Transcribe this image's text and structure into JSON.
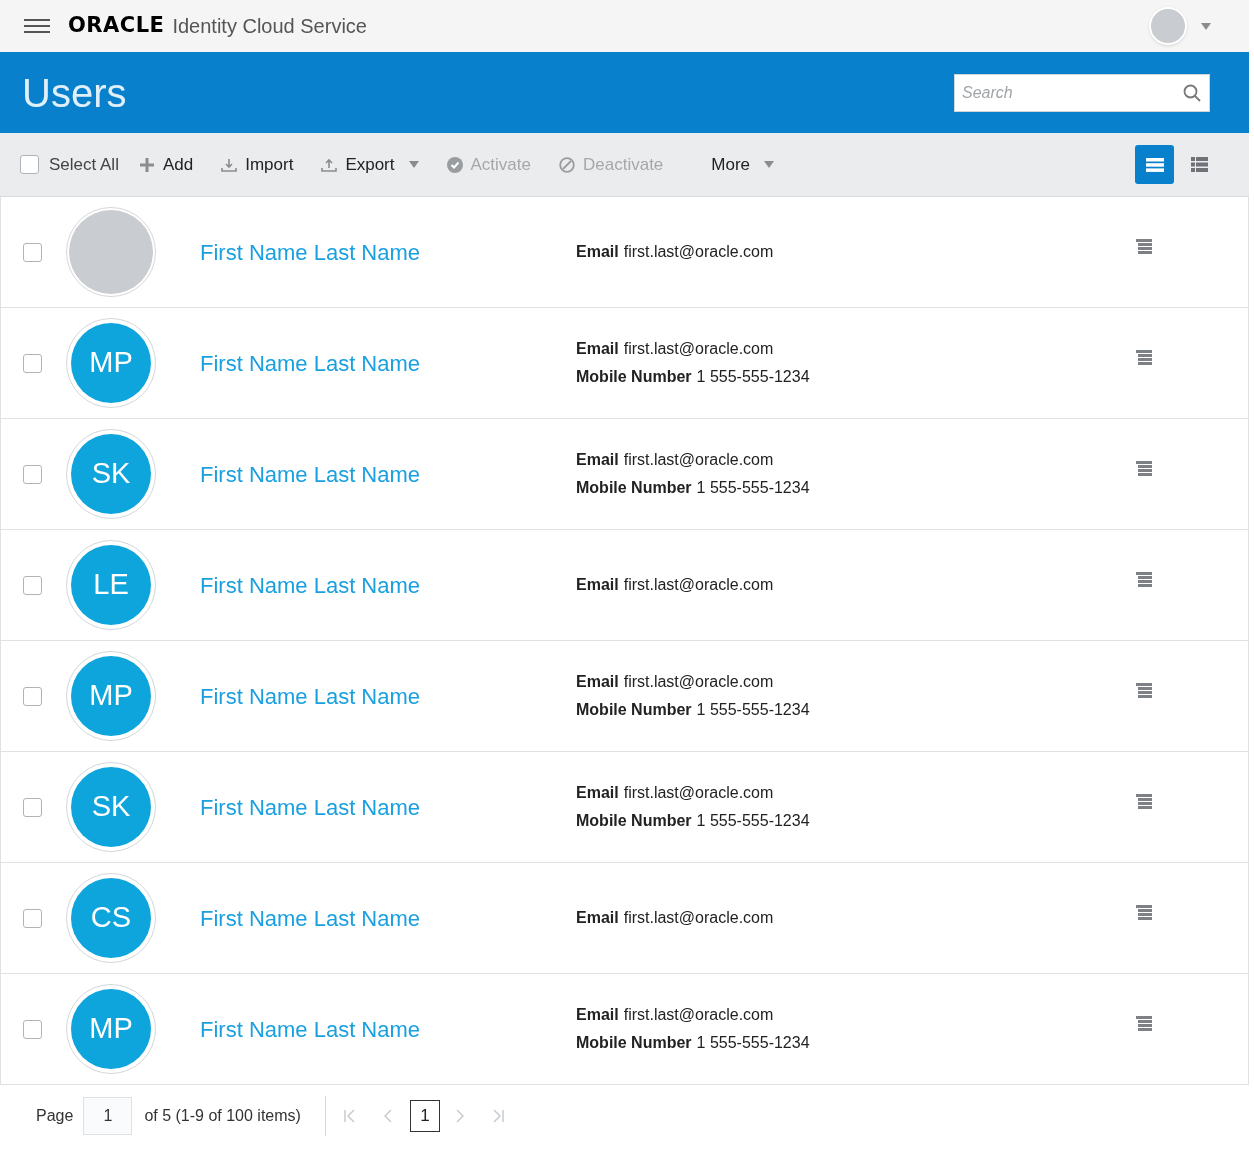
{
  "header": {
    "logo": "ORACLE",
    "product": "Identity Cloud Service"
  },
  "banner": {
    "title": "Users",
    "search": {
      "placeholder": "Search"
    }
  },
  "toolbar": {
    "select_all": {
      "label": "Select All",
      "checked": false
    },
    "actions": [
      {
        "kind": "add",
        "label": "Add",
        "disabled": false,
        "dropdown": false
      },
      {
        "kind": "import",
        "label": "Import",
        "disabled": false,
        "dropdown": false
      },
      {
        "kind": "export",
        "label": "Export",
        "disabled": false,
        "dropdown": true
      },
      {
        "kind": "activate",
        "label": "Activate",
        "disabled": true,
        "dropdown": false
      },
      {
        "kind": "deactivate",
        "label": "Deactivate",
        "disabled": true,
        "dropdown": false
      },
      {
        "kind": "more",
        "label": "More",
        "disabled": false,
        "dropdown": true
      }
    ],
    "views": [
      {
        "kind": "list",
        "selected": true
      },
      {
        "kind": "grid",
        "selected": false
      }
    ]
  },
  "users": [
    {
      "kind": "photo",
      "name": "First Name Last Name",
      "checked": false,
      "fields": [
        {
          "label": "Email",
          "value": "first.last@oracle.com"
        }
      ]
    },
    {
      "kind": "initials",
      "initials": "MP",
      "name": "First Name Last Name",
      "checked": false,
      "fields": [
        {
          "label": "Email",
          "value": "first.last@oracle.com"
        },
        {
          "label": "Mobile Number",
          "value": "1 555-555-1234"
        }
      ]
    },
    {
      "kind": "initials",
      "initials": "SK",
      "name": "First Name Last Name",
      "checked": false,
      "fields": [
        {
          "label": "Email",
          "value": "first.last@oracle.com"
        },
        {
          "label": "Mobile Number",
          "value": "1 555-555-1234"
        }
      ]
    },
    {
      "kind": "initials",
      "initials": "LE",
      "name": "First Name Last Name",
      "checked": false,
      "fields": [
        {
          "label": "Email",
          "value": "first.last@oracle.com"
        }
      ]
    },
    {
      "kind": "initials",
      "initials": "MP",
      "name": "First Name Last Name",
      "checked": false,
      "fields": [
        {
          "label": "Email",
          "value": "first.last@oracle.com"
        },
        {
          "label": "Mobile Number",
          "value": "1 555-555-1234"
        }
      ]
    },
    {
      "kind": "initials",
      "initials": "SK",
      "name": "First Name Last Name",
      "checked": false,
      "fields": [
        {
          "label": "Email",
          "value": "first.last@oracle.com"
        },
        {
          "label": "Mobile Number",
          "value": "1 555-555-1234"
        }
      ]
    },
    {
      "kind": "initials",
      "initials": "CS",
      "name": "First Name Last Name",
      "checked": false,
      "fields": [
        {
          "label": "Email",
          "value": "first.last@oracle.com"
        }
      ]
    },
    {
      "kind": "initials",
      "initials": "MP",
      "name": "First Name Last Name",
      "checked": false,
      "fields": [
        {
          "label": "Email",
          "value": "first.last@oracle.com"
        },
        {
          "label": "Mobile Number",
          "value": "1 555-555-1234"
        }
      ]
    }
  ],
  "pagination": {
    "label": "Page",
    "page": "1",
    "summary": "of 5 (1-9 of 100 items)",
    "pages": [
      {
        "label": "1",
        "selected": true
      }
    ]
  }
}
